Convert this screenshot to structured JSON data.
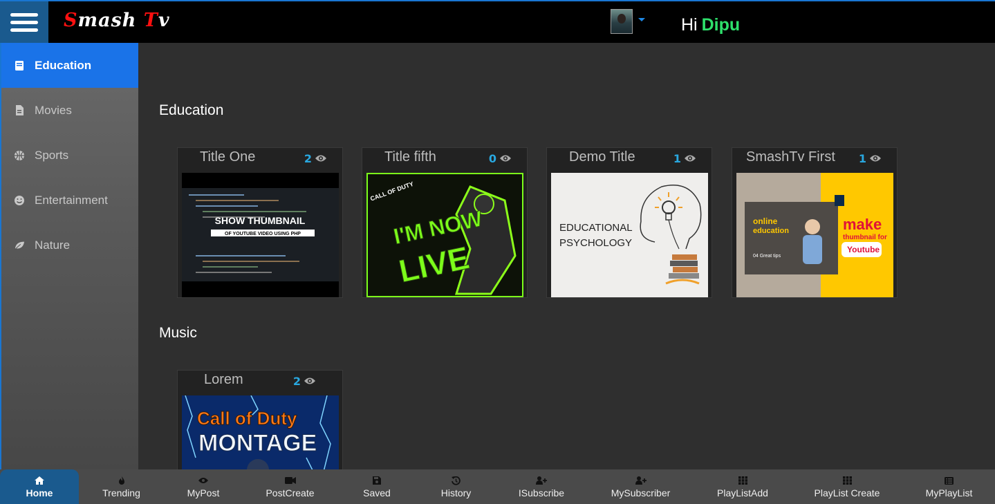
{
  "app": {
    "logo_first": "S",
    "logo_mid": "mash ",
    "logo_t": "T",
    "logo_last": "v"
  },
  "header": {
    "greeting": "Hi",
    "username": "Dipu"
  },
  "sidebar": {
    "items": [
      {
        "label": "Education",
        "icon": "book-icon",
        "active": true
      },
      {
        "label": "Movies",
        "icon": "file-icon"
      },
      {
        "label": "Sports",
        "icon": "basketball-icon"
      },
      {
        "label": "Entertainment",
        "icon": "smile-icon"
      },
      {
        "label": "Nature",
        "icon": "leaf-icon"
      }
    ]
  },
  "sections": [
    {
      "title": "Education",
      "cards": [
        {
          "title": "Title One",
          "views": "2",
          "thumb_lines": [
            "SHOW THUMBNAIL",
            "OF YOUTUBE VIDEO USING PHP"
          ]
        },
        {
          "title": "Title fifth",
          "views": "0",
          "thumb_lines": [
            "CALL OF DUTY",
            "I'M NOW",
            "LIVE"
          ]
        },
        {
          "title": "Demo Title",
          "views": "1",
          "thumb_lines": [
            "EDUCATIONAL",
            "PSYCHOLOGY"
          ]
        },
        {
          "title": "SmashTv First",
          "views": "1",
          "thumb_lines": [
            "online",
            "education",
            "04 Great tips",
            "make",
            "thumbnail for",
            "Youtube"
          ]
        }
      ]
    },
    {
      "title": "Music",
      "cards": [
        {
          "title": "Lorem",
          "views": "2",
          "thumb_lines": [
            "Call of Duty",
            "MONTAGE"
          ]
        }
      ]
    }
  ],
  "bottom_nav": [
    {
      "label": "Home",
      "icon": "home-icon",
      "active": true
    },
    {
      "label": "Trending",
      "icon": "fire-icon"
    },
    {
      "label": "MyPost",
      "icon": "eye-icon"
    },
    {
      "label": "PostCreate",
      "icon": "video-camera-icon"
    },
    {
      "label": "Saved",
      "icon": "save-icon"
    },
    {
      "label": "History",
      "icon": "history-icon"
    },
    {
      "label": "ISubscribe",
      "icon": "user-plus-icon"
    },
    {
      "label": "MySubscriber",
      "icon": "user-plus-icon"
    },
    {
      "label": "PlayListAdd",
      "icon": "grid-icon"
    },
    {
      "label": "PlayList Create",
      "icon": "grid-icon"
    },
    {
      "label": "MyPlayList",
      "icon": "list-icon"
    }
  ],
  "colors": {
    "accent": "#1a73e8",
    "username": "#2ee06b",
    "views": "#29a8e0",
    "logo_red": "#ff1010"
  }
}
